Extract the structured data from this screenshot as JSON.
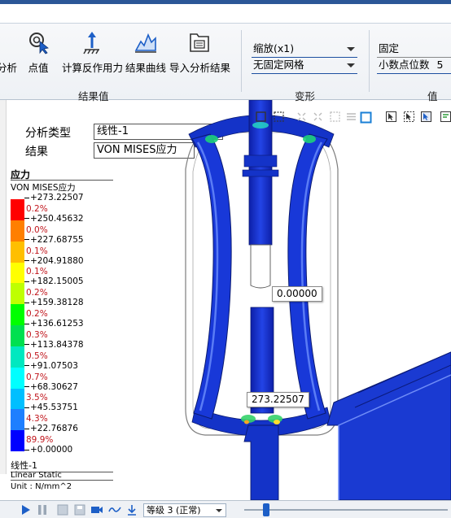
{
  "ribbon": {
    "buttons": [
      {
        "label": "分析",
        "icon": "analysis-icon"
      },
      {
        "label": "点值",
        "icon": "probe-icon"
      },
      {
        "label": "计算反作用力",
        "icon": "reaction-force-icon"
      },
      {
        "label": "结果曲线",
        "icon": "result-curve-icon"
      },
      {
        "label": "导入分析结果",
        "icon": "import-result-icon"
      }
    ],
    "group_results_label": "结果值",
    "deform_scale": "缩放(x1)",
    "deform_mode": "无固定网格",
    "group_deform_label": "变形",
    "value_mode": "固定",
    "decimal_label": "小数点位数",
    "decimal_value": "5",
    "group_value_label": "值"
  },
  "info": {
    "analysis_type_label": "分析类型",
    "analysis_type_value": "线性-1",
    "result_label": "结果",
    "result_value": "VON MISES应力"
  },
  "legend": {
    "title": "应力",
    "subtitle": "VON MISES应力",
    "values": [
      "+273.22507",
      "+250.45632",
      "+227.68755",
      "+204.91880",
      "+182.15005",
      "+159.38128",
      "+136.61253",
      "+113.84378",
      "+91.07503",
      "+68.30627",
      "+45.53751",
      "+22.76876",
      "+0.00000"
    ],
    "percents": [
      "0.2%",
      "0.0%",
      "0.1%",
      "0.1%",
      "0.2%",
      "0.2%",
      "0.3%",
      "0.5%",
      "0.7%",
      "3.5%",
      "4.3%",
      "89.9%"
    ],
    "colors": [
      "#ff0000",
      "#ff7f00",
      "#ffbf00",
      "#ffff00",
      "#bfff00",
      "#00ff00",
      "#00e050",
      "#00e8c0",
      "#00ffff",
      "#00bfff",
      "#1e7fff",
      "#0000ff"
    ],
    "footer_case": "线性-1",
    "footer_type": "Linear Static",
    "footer_unit": "Unit : N/mm^2"
  },
  "viewport": {
    "probe_min": "0.00000",
    "probe_max": "273.22507"
  },
  "bottombar": {
    "quality": "等级 3 (正常)"
  },
  "colors": {
    "ribbon_blue": "#2b5797",
    "part_blue": "#1433c8",
    "accent": "#1d5fc7"
  }
}
